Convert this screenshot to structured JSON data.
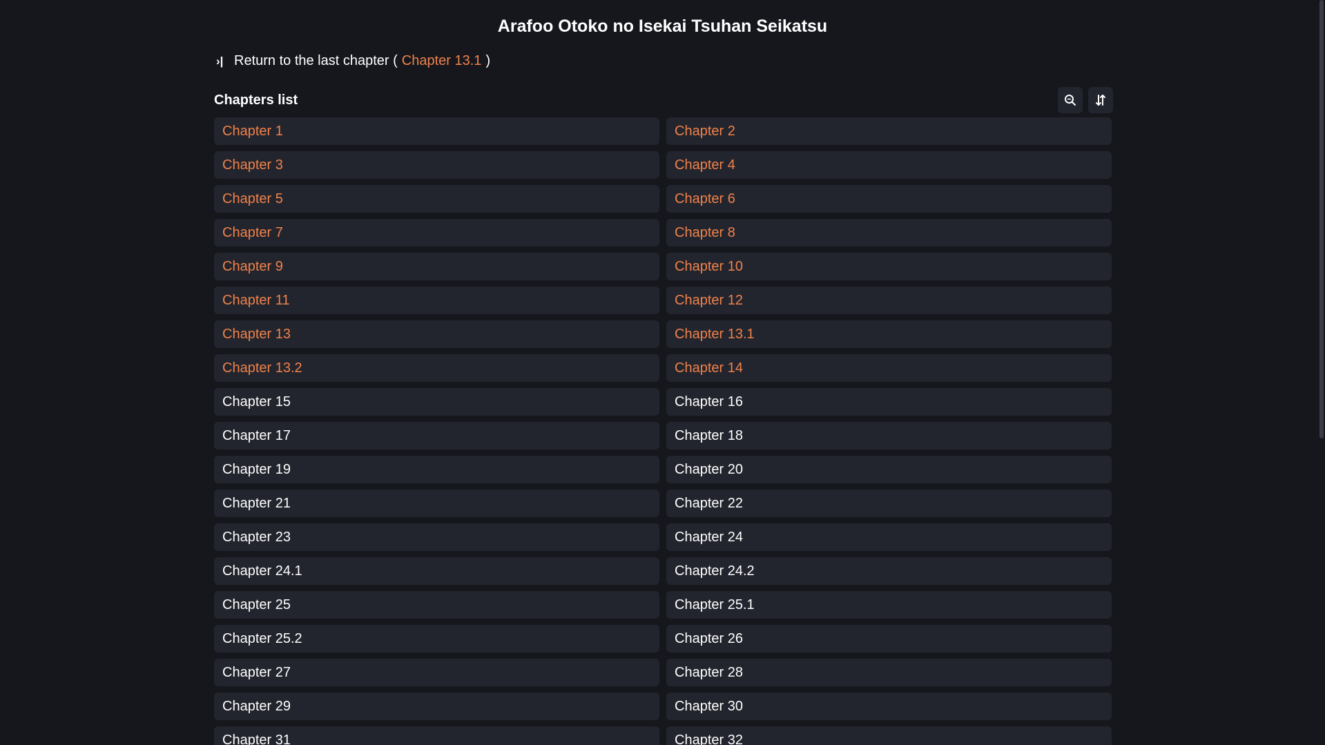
{
  "manga_title": "Arafoo Otoko no Isekai Tsuhan Seikatsu",
  "return": {
    "prefix": "Return to the last chapter (",
    "chapter": "Chapter 13.1",
    "suffix": ")"
  },
  "list": {
    "title": "Chapters list",
    "search_icon": "search-icon",
    "sort_icon": "sort-icon"
  },
  "colors": {
    "background": "#15171d",
    "card": "#23252e",
    "read_accent": "#f0824a",
    "text": "#ffffff"
  },
  "chapters": [
    {
      "label": "Chapter 1",
      "read": true
    },
    {
      "label": "Chapter 2",
      "read": true
    },
    {
      "label": "Chapter 3",
      "read": true
    },
    {
      "label": "Chapter 4",
      "read": true
    },
    {
      "label": "Chapter 5",
      "read": true
    },
    {
      "label": "Chapter 6",
      "read": true
    },
    {
      "label": "Chapter 7",
      "read": true
    },
    {
      "label": "Chapter 8",
      "read": true
    },
    {
      "label": "Chapter 9",
      "read": true
    },
    {
      "label": "Chapter 10",
      "read": true
    },
    {
      "label": "Chapter 11",
      "read": true
    },
    {
      "label": "Chapter 12",
      "read": true
    },
    {
      "label": "Chapter 13",
      "read": true
    },
    {
      "label": "Chapter 13.1",
      "read": true
    },
    {
      "label": "Chapter 13.2",
      "read": true
    },
    {
      "label": "Chapter 14",
      "read": true
    },
    {
      "label": "Chapter 15",
      "read": false
    },
    {
      "label": "Chapter 16",
      "read": false
    },
    {
      "label": "Chapter 17",
      "read": false
    },
    {
      "label": "Chapter 18",
      "read": false
    },
    {
      "label": "Chapter 19",
      "read": false
    },
    {
      "label": "Chapter 20",
      "read": false
    },
    {
      "label": "Chapter 21",
      "read": false
    },
    {
      "label": "Chapter 22",
      "read": false
    },
    {
      "label": "Chapter 23",
      "read": false
    },
    {
      "label": "Chapter 24",
      "read": false
    },
    {
      "label": "Chapter 24.1",
      "read": false
    },
    {
      "label": "Chapter 24.2",
      "read": false
    },
    {
      "label": "Chapter 25",
      "read": false
    },
    {
      "label": "Chapter 25.1",
      "read": false
    },
    {
      "label": "Chapter 25.2",
      "read": false
    },
    {
      "label": "Chapter 26",
      "read": false
    },
    {
      "label": "Chapter 27",
      "read": false
    },
    {
      "label": "Chapter 28",
      "read": false
    },
    {
      "label": "Chapter 29",
      "read": false
    },
    {
      "label": "Chapter 30",
      "read": false
    },
    {
      "label": "Chapter 31",
      "read": false
    },
    {
      "label": "Chapter 32",
      "read": false
    }
  ]
}
